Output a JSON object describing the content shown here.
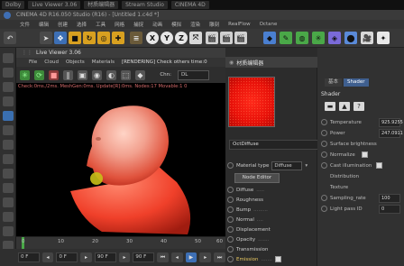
{
  "taskbar": {
    "items": [
      "Dolby",
      "",
      "Live Viewer 3.06",
      "",
      "材质编辑器",
      "Stream Studio",
      "",
      "CINEMA 4D"
    ]
  },
  "app": {
    "title": "CINEMA 4D R16.050 Studio (R16) - [Untitled 1.c4d *]"
  },
  "menu": {
    "items": [
      "文件",
      "编辑",
      "创建",
      "选择",
      "工具",
      "网格",
      "捕捉",
      "动画",
      "模拟",
      "渲染",
      "雕刻",
      "运动跟踪",
      "运动图形",
      "角色",
      "流水线",
      "插件",
      "RealFlow",
      "Octane",
      "脚本",
      "窗口"
    ]
  },
  "toolbar": {
    "axis": [
      "X",
      "Y",
      "Z"
    ]
  },
  "viewer": {
    "title": "Live Viewer 3.06",
    "menu": [
      "File",
      "Cloud",
      "Objects",
      "Materials"
    ],
    "rendering_note": "[RENDERING] Check others time:0",
    "channel_label": "Chn:",
    "channel_value": "DL",
    "status": "Check:0ms./2ms. MeshGen:0ms. Update[R]:0ms. Nodes:17 Movable:1 0"
  },
  "timeline": {
    "ticks": [
      "0",
      "10",
      "20",
      "30",
      "40",
      "50",
      "60"
    ],
    "start_field": "0 F",
    "current_field": "0 F",
    "end_field": "90 F",
    "end_field2": "90 F"
  },
  "material_editor": {
    "title": "材质编辑器",
    "material_name": "OctDiffuse",
    "material_type_label": "Material type",
    "material_type_value": "Diffuse",
    "node_editor_label": "Node Editor",
    "channels": [
      "Diffuse",
      "Roughness",
      "Bump",
      "Normal",
      "Displacement",
      "Opacity",
      "Transmission",
      "Emission"
    ]
  },
  "shader_panel": {
    "tabs": [
      "基本",
      "Shader"
    ],
    "section": "Shader",
    "params": [
      {
        "label": "Temperature",
        "value": "925.9255",
        "sub": false
      },
      {
        "label": "Power",
        "value": "247.0911",
        "sub": false
      },
      {
        "label": "Surface brightness",
        "value": "",
        "sub": false
      },
      {
        "label": "Normalize",
        "value": "",
        "sub": false
      },
      {
        "label": "Cast illumination",
        "value": "",
        "sub": false
      },
      {
        "label": "Distribution",
        "value": "",
        "sub": true
      },
      {
        "label": "Texture",
        "value": "",
        "sub": true
      },
      {
        "label": "Sampling_rate",
        "value": "100",
        "sub": false
      },
      {
        "label": "Light pass ID",
        "value": "0",
        "sub": false
      }
    ]
  },
  "colors": {
    "accent_blue": "#3f5f8f",
    "render_red": "#e8120a",
    "skin": "#f2a08e"
  }
}
